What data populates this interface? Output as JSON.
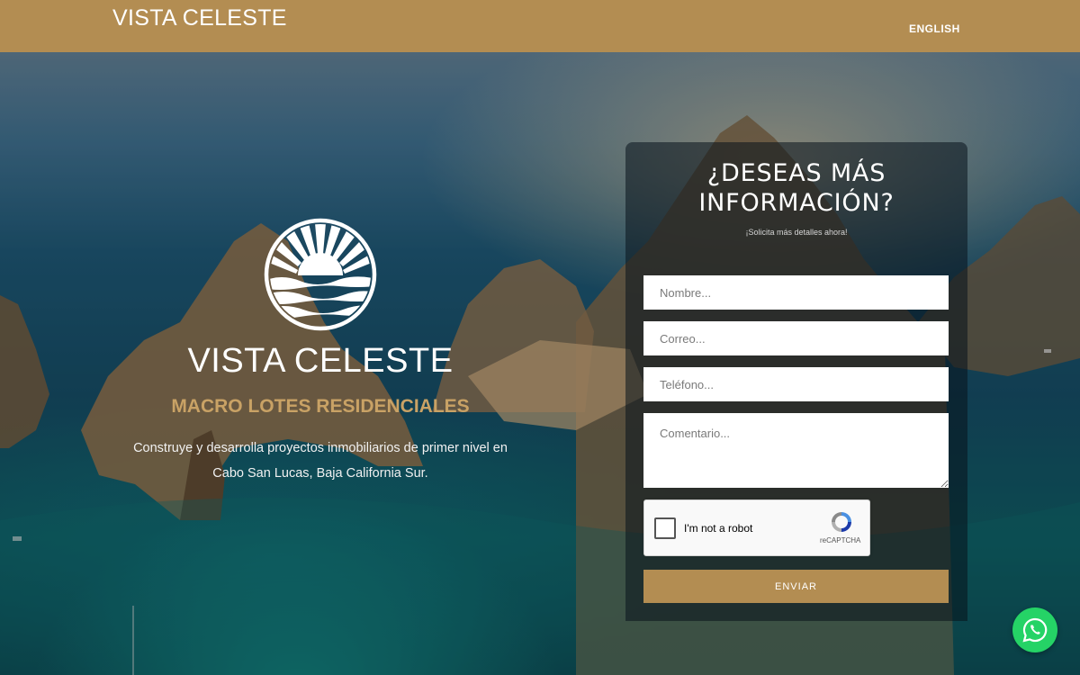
{
  "header": {
    "brand": "VISTA CELESTE",
    "language_link": "ENGLISH"
  },
  "hero": {
    "logo_text": "VISTA CELESTE",
    "subtitle": "MACRO LOTES RESIDENCIALES",
    "description": "Construye y desarrolla proyectos inmobiliarios de primer nivel en Cabo San Lucas, Baja California Sur."
  },
  "form": {
    "title_line1": "¿DESEAS MÁS",
    "title_line2": "INFORMACIÓN?",
    "subtitle": "¡Solicita más detalles ahora!",
    "name_placeholder": "Nombre...",
    "email_placeholder": "Correo...",
    "phone_placeholder": "Teléfono...",
    "comment_placeholder": "Comentario...",
    "captcha_label": "I'm not a robot",
    "captcha_brand": "reCAPTCHA",
    "submit_label": "ENVIAR"
  },
  "colors": {
    "gold": "#b38d52",
    "subtitle_gold": "#c9a265",
    "whatsapp": "#25d366"
  },
  "icons": {
    "logo": "sun-over-waves-emblem",
    "captcha": "recaptcha-icon",
    "chat": "whatsapp-icon"
  }
}
